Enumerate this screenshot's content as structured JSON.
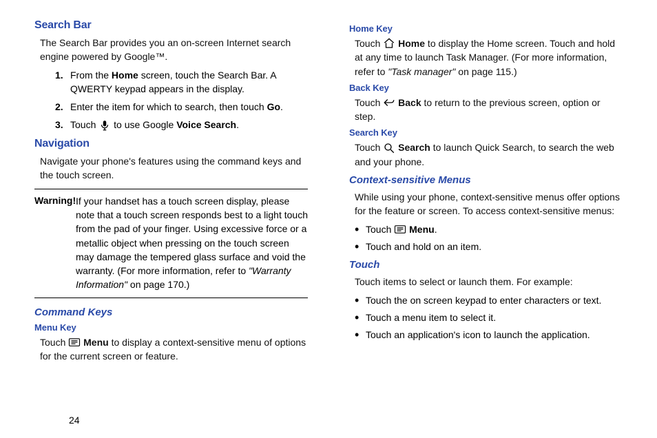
{
  "left": {
    "searchBar": {
      "title": "Search Bar",
      "intro_a": "The Search Bar provides you an on-screen Internet search engine powered by Google™.",
      "step1_a": "From the ",
      "step1_b": "Home",
      "step1_c": " screen, touch the Search Bar. A QWERTY keypad appears in the display.",
      "step2_a": "Enter the item for which to search, then touch ",
      "step2_b": "Go",
      "step2_c": ".",
      "step3_a": "Touch ",
      "step3_b": " to use Google ",
      "step3_c": "Voice Search",
      "step3_d": "."
    },
    "navigation": {
      "title": "Navigation",
      "intro": "Navigate your phone's features using the command keys and the touch screen."
    },
    "warning": {
      "label": "Warning!",
      "text_a": "If your handset has a touch screen display, please note that a touch screen responds best to a light touch from the pad of your finger. Using excessive force or a metallic object when pressing on the touch screen may damage the tempered glass surface and void the warranty. (For more information, refer to ",
      "text_b": "\"Warranty Information\"",
      "text_c": "  on page 170.)"
    },
    "commandKeys": {
      "title": "Command Keys",
      "menuKey": {
        "title": "Menu Key",
        "a": "Touch ",
        "b": "Menu",
        "c": " to display a context-sensitive menu of options for the current screen or feature."
      }
    }
  },
  "right": {
    "homeKey": {
      "title": "Home Key",
      "a": "Touch ",
      "b": "Home",
      "c": " to display the Home screen. Touch and hold at any time to launch Task Manager. (For more information, refer to ",
      "d": "\"Task manager\"",
      "e": "  on page 115.)"
    },
    "backKey": {
      "title": "Back Key",
      "a": "Touch ",
      "b": "Back",
      "c": " to return to the previous screen, option or step."
    },
    "searchKey": {
      "title": "Search Key",
      "a": "Touch ",
      "b": "Search",
      "c": " to launch Quick Search, to search the web and your phone."
    },
    "context": {
      "title": "Context-sensitive Menus",
      "intro": "While using your phone, context-sensitive menus offer options for the feature or screen. To access context-sensitive menus:",
      "bullet1_a": "Touch ",
      "bullet1_b": "Menu",
      "bullet1_c": ".",
      "bullet2": "Touch and hold on an item."
    },
    "touch": {
      "title": "Touch",
      "intro": "Touch items to select or launch them. For example:",
      "bullet1": "Touch the on screen keypad to enter characters or text.",
      "bullet2": "Touch a menu item to select it.",
      "bullet3": "Touch an application's icon to launch the application."
    }
  },
  "page": "24"
}
